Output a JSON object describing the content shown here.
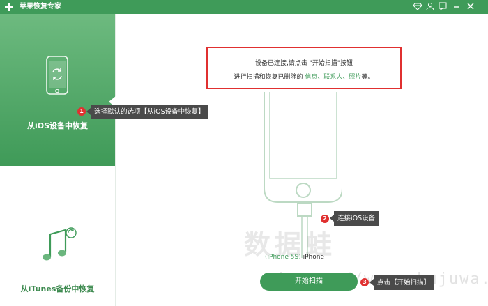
{
  "window": {
    "title": "苹果恢复专家"
  },
  "sidebar": {
    "items": [
      {
        "label": "从iOS设备中恢复",
        "icon": "phone-refresh-icon",
        "active": true
      },
      {
        "label": "从iTunes备份中恢复",
        "icon": "music-refresh-icon",
        "active": false
      }
    ]
  },
  "info": {
    "line1": "设备已连接,请点击 \"开始扫描\"按钮",
    "line2_prefix": "进行扫描和恢复已删除的 ",
    "line2_links": "信息、联系人、照片",
    "line2_suffix": "等。"
  },
  "device": {
    "model": "(iPhone 5S)",
    "name": " iPhone"
  },
  "start_button": {
    "label": "开始扫描"
  },
  "callouts": [
    {
      "number": "1",
      "text": "选择默认的选项【从iOS设备中恢复】"
    },
    {
      "number": "2",
      "text": "连接iOS设备"
    },
    {
      "number": "3",
      "text": "点击【开始扫描】"
    }
  ],
  "watermark": {
    "text": "数据蛙",
    "url": "https://www.shujuwa.net"
  },
  "colors": {
    "brand": "#3f9b59",
    "highlight_border": "#e03030",
    "callout_bg": "#4a4a4a"
  }
}
